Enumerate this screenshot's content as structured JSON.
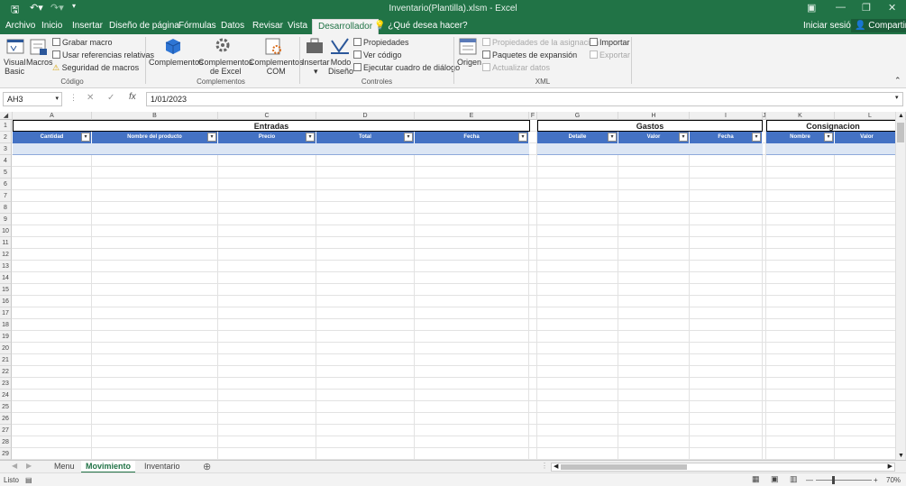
{
  "titlebar": {
    "title": "Inventario(Plantilla).xlsm - Excel",
    "save_icon": "save-icon",
    "undo_icon": "undo-icon",
    "redo_icon": "redo-icon"
  },
  "menu": {
    "tabs": [
      "Archivo",
      "Inicio",
      "Insertar",
      "Diseño de página",
      "Fórmulas",
      "Datos",
      "Revisar",
      "Vista",
      "Desarrollador"
    ],
    "active_tab": "Desarrollador",
    "tell_me": "¿Qué desea hacer?",
    "signin": "Iniciar sesión",
    "share": "Compartir"
  },
  "ribbon": {
    "codigo": {
      "group": "Código",
      "visual_basic_1": "Visual",
      "visual_basic_2": "Basic",
      "macros": "Macros",
      "grabar": "Grabar macro",
      "usar_ref": "Usar referencias relativas",
      "seguridad": "Seguridad de macros"
    },
    "complementos": {
      "group": "Complementos",
      "comp": "Complementos",
      "comp_excel_1": "Complementos",
      "comp_excel_2": "de Excel",
      "comp_com_1": "Complementos",
      "comp_com_2": "COM"
    },
    "controles": {
      "group": "Controles",
      "insertar": "Insertar",
      "modo_1": "Modo",
      "modo_2": "Diseño",
      "propiedades": "Propiedades",
      "ver_codigo": "Ver código",
      "ejecutar": "Ejecutar cuadro de diálogo"
    },
    "xml": {
      "group": "XML",
      "origen": "Origen",
      "prop_asig": "Propiedades de la asignación",
      "paquetes": "Paquetes de expansión",
      "actualizar": "Actualizar datos",
      "importar": "Importar",
      "exportar": "Exportar"
    }
  },
  "formula_bar": {
    "name_box": "AH3",
    "formula": "1/01/2023"
  },
  "columns": [
    "A",
    "B",
    "C",
    "D",
    "E",
    "F",
    "G",
    "H",
    "I",
    "J",
    "K",
    "L"
  ],
  "rows": [
    "1",
    "2",
    "3",
    "4",
    "5",
    "6",
    "7",
    "8",
    "9",
    "10",
    "11",
    "12",
    "13",
    "14",
    "15",
    "16",
    "17",
    "18",
    "19",
    "20",
    "21",
    "22",
    "23",
    "24",
    "25",
    "26",
    "27",
    "28",
    "29"
  ],
  "sections": {
    "entradas": "Entradas",
    "gastos": "Gastos",
    "consignacion": "Consignacion"
  },
  "headers": {
    "entradas": [
      "Cantidad",
      "Nombre del producto",
      "Precio",
      "Total",
      "Fecha"
    ],
    "gastos": [
      "Detalle",
      "Valor",
      "Fecha"
    ],
    "consignacion": [
      "Nombre",
      "Valor"
    ]
  },
  "colors": {
    "excel_green": "#217346",
    "table_header": "#4472c4",
    "table_band": "#dce6f4"
  },
  "sheets": [
    "Menu",
    "Movimiento",
    "Inventario"
  ],
  "active_sheet": "Movimiento",
  "status": {
    "mode": "Listo",
    "zoom": "70%"
  }
}
